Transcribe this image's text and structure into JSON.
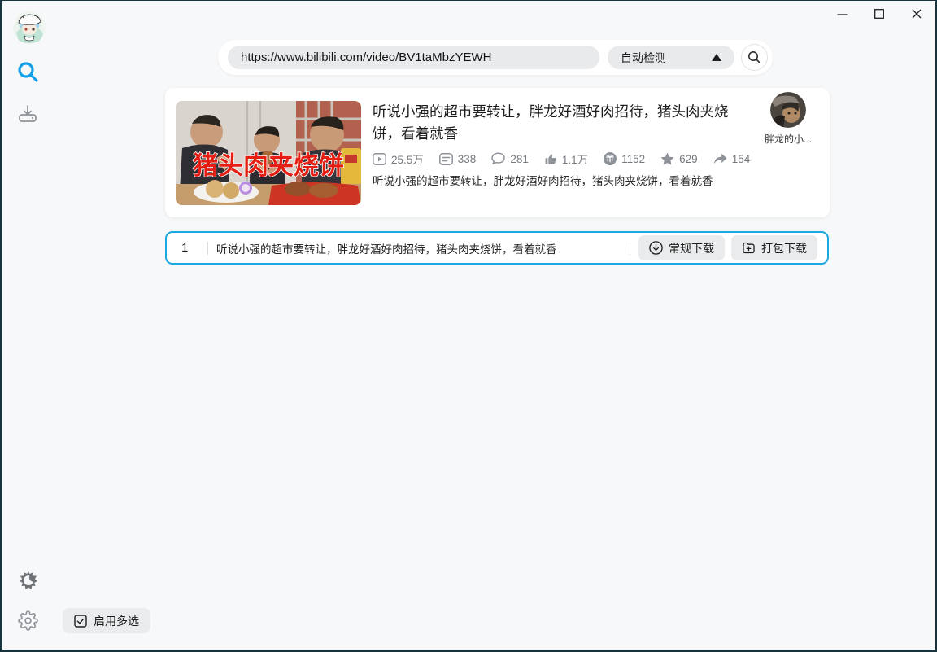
{
  "topbar": {
    "url_value": "https://www.bilibili.com/video/BV1taMbzYEWH",
    "detect_label": "自动检测"
  },
  "video_card": {
    "title": "听说小强的超市要转让，胖龙好酒好肉招待，猪头肉夹烧饼，看着就香",
    "description": "听说小强的超市要转让，胖龙好酒好肉招待，猪头肉夹烧饼，看着就香",
    "thumbnail_overlay_text": "猪头肉夹烧饼",
    "uploader_name": "胖龙的小...",
    "stats": [
      {
        "icon": "play-count-icon",
        "value": "25.5万"
      },
      {
        "icon": "danmaku-icon",
        "value": "338"
      },
      {
        "icon": "comment-icon",
        "value": "281"
      },
      {
        "icon": "like-icon",
        "value": "1.1万"
      },
      {
        "icon": "coin-icon",
        "value": "1152"
      },
      {
        "icon": "favorite-icon",
        "value": "629"
      },
      {
        "icon": "share-icon",
        "value": "154"
      }
    ]
  },
  "download_row": {
    "index": "1",
    "title": "听说小强的超市要转让，胖龙好酒好肉招待，猪头肉夹烧饼，看着就香",
    "regular_download_label": "常规下载",
    "package_download_label": "打包下载"
  },
  "bottom": {
    "multi_select_label": "启用多选"
  },
  "colors": {
    "accent_blue": "#13a0e8",
    "active_border_blue": "#1ba7df",
    "window_edge": "#18333b",
    "background": "#f7f8f9",
    "pill_gray": "#e9eaec"
  }
}
